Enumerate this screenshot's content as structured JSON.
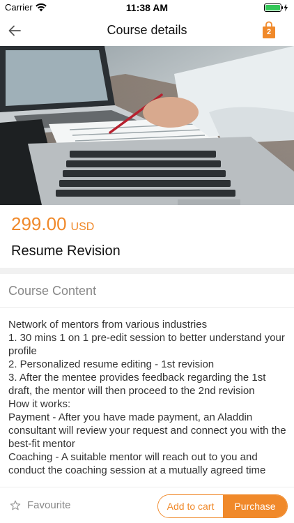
{
  "status_bar": {
    "carrier": "Carrier",
    "time": "11:38 AM"
  },
  "nav": {
    "title": "Course details",
    "cart_count": "2",
    "back_icon": "back-arrow-icon",
    "cart_icon": "shopping-bag-icon"
  },
  "hero": {
    "image": "laptop-and-document-photo"
  },
  "course": {
    "price": "299.00",
    "currency": "USD",
    "title": "Resume Revision"
  },
  "content_section": {
    "title": "Course Content",
    "lines": [
      "Network of mentors from various industries",
      "1.  30 mins 1 on 1 pre-edit session to better understand your profile",
      "2.  Personalized resume editing - 1st revision",
      "3.  After the mentee provides feedback regarding the 1st draft, the mentor will then proceed to the 2nd revision",
      "How it works:",
      "Payment - After you have made payment, an Aladdin consultant will review your request and connect you with the best-fit mentor",
      "Coaching - A suitable mentor will reach out to you and conduct the coaching session at a mutually agreed time"
    ]
  },
  "bottom_bar": {
    "favourite_label": "Favourite",
    "add_to_cart_label": "Add to cart",
    "purchase_label": "Purchase"
  },
  "colors": {
    "accent": "#f0892a",
    "muted_text": "#888888",
    "band": "#f1f1f1",
    "battery_green": "#34c759"
  }
}
